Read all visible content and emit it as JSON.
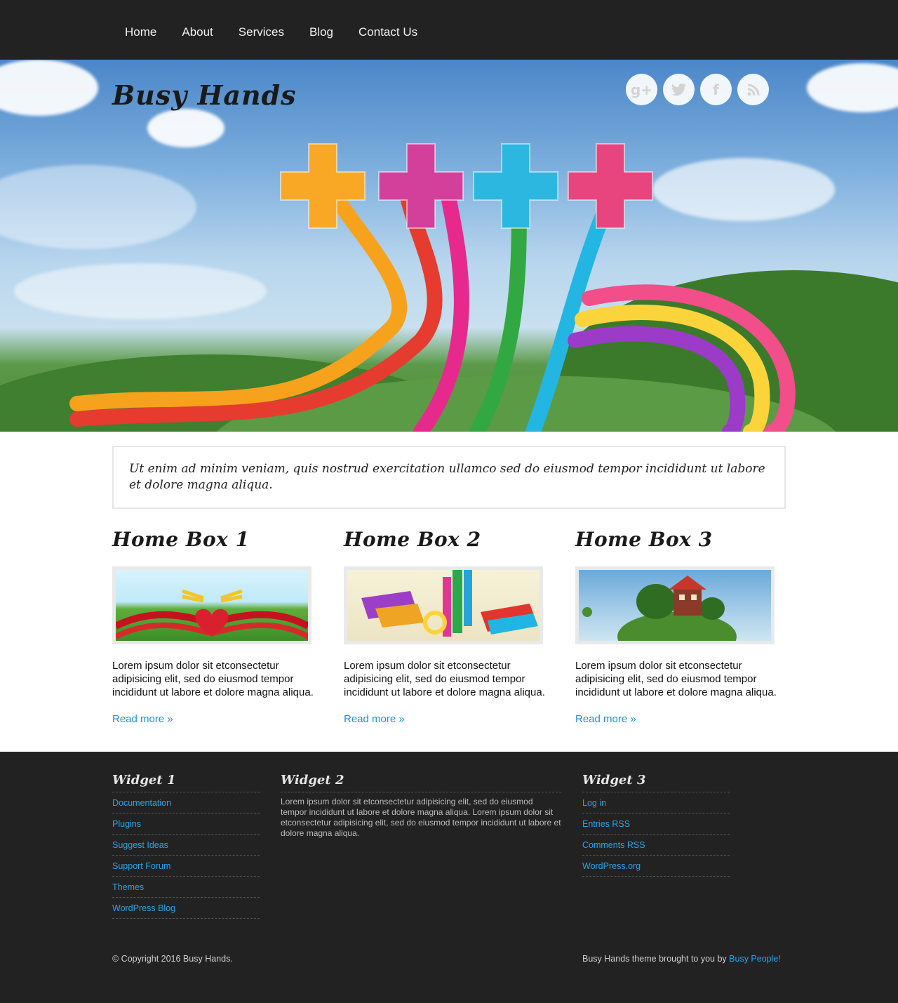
{
  "nav": {
    "items": [
      {
        "label": "Home"
      },
      {
        "label": "About"
      },
      {
        "label": "Services"
      },
      {
        "label": "Blog"
      },
      {
        "label": "Contact Us"
      }
    ]
  },
  "hero": {
    "site_title": "Busy Hands",
    "social": [
      {
        "icon": "google-plus-icon",
        "glyph": "g+"
      },
      {
        "icon": "twitter-icon",
        "glyph": "🐦"
      },
      {
        "icon": "facebook-icon",
        "glyph": "f"
      },
      {
        "icon": "rss-icon",
        "glyph": "◔"
      }
    ]
  },
  "intro": {
    "text": "Ut enim ad minim veniam, quis nostrud exercitation ullamco sed do eiusmod tempor incididunt ut labore et dolore magna aliqua."
  },
  "boxes": [
    {
      "title": "Home Box 1",
      "text": "Lorem ipsum dolor sit etconsectetur adipisicing elit, sed do eiusmod tempor incididunt ut labore et dolore magna aliqua.",
      "link": "Read more »"
    },
    {
      "title": "Home Box 2",
      "text": "Lorem ipsum dolor sit etconsectetur adipisicing elit, sed do eiusmod tempor incididunt ut labore et dolore magna aliqua.",
      "link": "Read more »"
    },
    {
      "title": "Home Box 3",
      "text": "Lorem ipsum dolor sit etconsectetur adipisicing elit, sed do eiusmod tempor incididunt ut labore et dolore magna aliqua.",
      "link": "Read more »"
    }
  ],
  "footer": {
    "widget1": {
      "title": "Widget 1",
      "links": [
        "Documentation",
        "Plugins",
        "Suggest Ideas",
        "Support Forum",
        "Themes",
        "WordPress Blog"
      ]
    },
    "widget2": {
      "title": "Widget 2",
      "text": "Lorem ipsum dolor sit etconsectetur adipisicing elit, sed do eiusmod tempor incididunt ut labore et dolore magna aliqua. Lorem ipsum dolor sit etconsectetur adipisicing elit, sed do eiusmod tempor incididunt ut labore et dolore magna aliqua."
    },
    "widget3": {
      "title": "Widget 3",
      "links": [
        "Log in",
        "Entries RSS",
        "Comments RSS",
        "WordPress.org"
      ]
    },
    "copyright": "© Copyright 2016 Busy Hands.",
    "credit_text": "Busy Hands theme brought to you by ",
    "credit_link": "Busy People!"
  },
  "colors": {
    "nav_bg": "#222222",
    "link": "#1e90d6",
    "footer_link": "#2ba3e6"
  }
}
